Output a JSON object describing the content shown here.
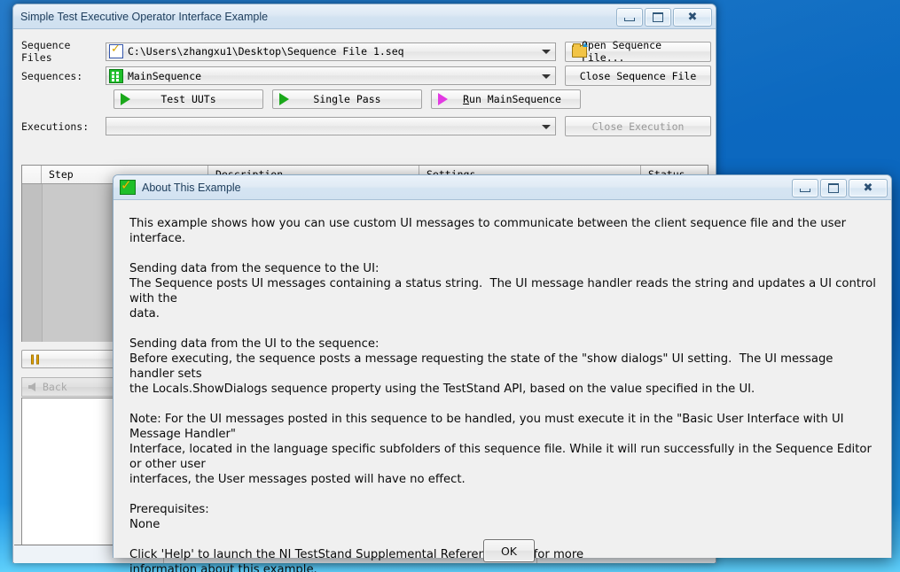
{
  "desktop": {
    "background_top": "#0d6cc2",
    "background_bottom": "#5fd0fb"
  },
  "main_window": {
    "title": "Simple Test Executive Operator Interface Example",
    "window_buttons": {
      "minimize": "minimize-icon",
      "maximize": "maximize-icon",
      "close": "close-icon"
    },
    "rows": {
      "sequence_files_label": "Sequence Files",
      "sequence_files_value": "C:\\Users\\zhangxu1\\Desktop\\Sequence File 1.seq",
      "sequences_label": "Sequences:",
      "sequences_value": "MainSequence",
      "executions_label": "Executions:",
      "executions_value": ""
    },
    "buttons": {
      "open_sequence_file": "Open Sequence File...",
      "close_sequence_file": "Close Sequence File",
      "close_execution": "Close Execution",
      "test_uuts": "Test UUTs",
      "single_pass": "Single Pass",
      "run_mainsequence": "Run MainSequence",
      "break": "Break",
      "back": "Back"
    },
    "table": {
      "columns": [
        "Step",
        "Description",
        "Settings",
        "Status"
      ],
      "rows": []
    }
  },
  "dialog": {
    "title": "About This Example",
    "icon": "teststand-check-icon",
    "window_buttons": {
      "minimize": "minimize-icon",
      "maximize": "maximize-icon",
      "close": "close-icon"
    },
    "body_text": "This example shows how you can use custom UI messages to communicate between the client sequence file and the user interface.\n\nSending data from the sequence to the UI:\nThe Sequence posts UI messages containing a status string.  The UI message handler reads the string and updates a UI control with the\ndata.\n\nSending data from the UI to the sequence:\nBefore executing, the sequence posts a message requesting the state of the \"show dialogs\" UI setting.  The UI message handler sets\nthe Locals.ShowDialogs sequence property using the TestStand API, based on the value specified in the UI.\n\nNote: For the UI messages posted in this sequence to be handled, you must execute it in the \"Basic User Interface with UI Message Handler\"\nInterface, located in the language specific subfolders of this sequence file. While it will run successfully in the Sequence Editor or other user\ninterfaces, the User messages posted will have no effect.\n\nPrerequisites:\nNone\n\nClick 'Help' to launch the NI TestStand Supplemental Reference Help for more\ninformation about this example.",
    "ok_button": "OK"
  }
}
